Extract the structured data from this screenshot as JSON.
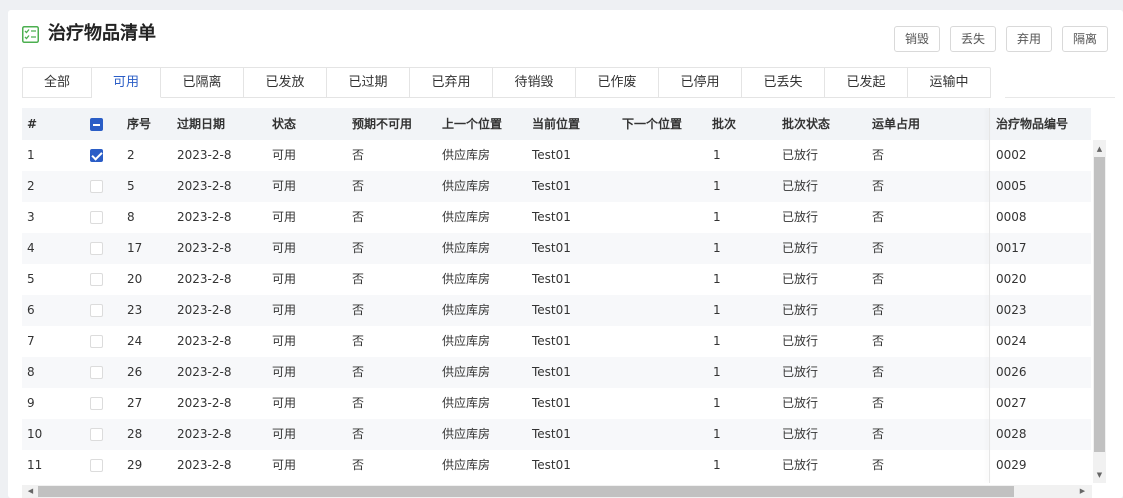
{
  "header": {
    "title": "治疗物品清单",
    "title_icon": "checklist-icon",
    "actions": [
      "销毁",
      "丢失",
      "弃用",
      "隔离"
    ]
  },
  "tabs": [
    "全部",
    "可用",
    "已隔离",
    "已发放",
    "已过期",
    "已弃用",
    "待销毁",
    "已作废",
    "已停用",
    "已丢失",
    "已发起",
    "运输中"
  ],
  "active_tab": "可用",
  "table": {
    "columns": [
      "#",
      "",
      "序号",
      "过期日期",
      "状态",
      "预期不可用",
      "上一个位置",
      "当前位置",
      "下一个位置",
      "批次",
      "批次状态",
      "运单占用",
      "治疗物品编号"
    ],
    "rows": [
      {
        "index": "1",
        "checked": true,
        "seq": "2",
        "expiry": "2023-2-8",
        "status": "可用",
        "expected_unavailable": "否",
        "prev_location": "供应库房",
        "current_location": "Test01",
        "next_location": "",
        "batch": "1",
        "batch_status": "已放行",
        "waybill": "否",
        "item_no": "0002"
      },
      {
        "index": "2",
        "checked": false,
        "seq": "5",
        "expiry": "2023-2-8",
        "status": "可用",
        "expected_unavailable": "否",
        "prev_location": "供应库房",
        "current_location": "Test01",
        "next_location": "",
        "batch": "1",
        "batch_status": "已放行",
        "waybill": "否",
        "item_no": "0005"
      },
      {
        "index": "3",
        "checked": false,
        "seq": "8",
        "expiry": "2023-2-8",
        "status": "可用",
        "expected_unavailable": "否",
        "prev_location": "供应库房",
        "current_location": "Test01",
        "next_location": "",
        "batch": "1",
        "batch_status": "已放行",
        "waybill": "否",
        "item_no": "0008"
      },
      {
        "index": "4",
        "checked": false,
        "seq": "17",
        "expiry": "2023-2-8",
        "status": "可用",
        "expected_unavailable": "否",
        "prev_location": "供应库房",
        "current_location": "Test01",
        "next_location": "",
        "batch": "1",
        "batch_status": "已放行",
        "waybill": "否",
        "item_no": "0017"
      },
      {
        "index": "5",
        "checked": false,
        "seq": "20",
        "expiry": "2023-2-8",
        "status": "可用",
        "expected_unavailable": "否",
        "prev_location": "供应库房",
        "current_location": "Test01",
        "next_location": "",
        "batch": "1",
        "batch_status": "已放行",
        "waybill": "否",
        "item_no": "0020"
      },
      {
        "index": "6",
        "checked": false,
        "seq": "23",
        "expiry": "2023-2-8",
        "status": "可用",
        "expected_unavailable": "否",
        "prev_location": "供应库房",
        "current_location": "Test01",
        "next_location": "",
        "batch": "1",
        "batch_status": "已放行",
        "waybill": "否",
        "item_no": "0023"
      },
      {
        "index": "7",
        "checked": false,
        "seq": "24",
        "expiry": "2023-2-8",
        "status": "可用",
        "expected_unavailable": "否",
        "prev_location": "供应库房",
        "current_location": "Test01",
        "next_location": "",
        "batch": "1",
        "batch_status": "已放行",
        "waybill": "否",
        "item_no": "0024"
      },
      {
        "index": "8",
        "checked": false,
        "seq": "26",
        "expiry": "2023-2-8",
        "status": "可用",
        "expected_unavailable": "否",
        "prev_location": "供应库房",
        "current_location": "Test01",
        "next_location": "",
        "batch": "1",
        "batch_status": "已放行",
        "waybill": "否",
        "item_no": "0026"
      },
      {
        "index": "9",
        "checked": false,
        "seq": "27",
        "expiry": "2023-2-8",
        "status": "可用",
        "expected_unavailable": "否",
        "prev_location": "供应库房",
        "current_location": "Test01",
        "next_location": "",
        "batch": "1",
        "batch_status": "已放行",
        "waybill": "否",
        "item_no": "0027"
      },
      {
        "index": "10",
        "checked": false,
        "seq": "28",
        "expiry": "2023-2-8",
        "status": "可用",
        "expected_unavailable": "否",
        "prev_location": "供应库房",
        "current_location": "Test01",
        "next_location": "",
        "batch": "1",
        "batch_status": "已放行",
        "waybill": "否",
        "item_no": "0028"
      },
      {
        "index": "11",
        "checked": false,
        "seq": "29",
        "expiry": "2023-2-8",
        "status": "可用",
        "expected_unavailable": "否",
        "prev_location": "供应库房",
        "current_location": "Test01",
        "next_location": "",
        "batch": "1",
        "batch_status": "已放行",
        "waybill": "否",
        "item_no": "0029"
      }
    ]
  },
  "colors": {
    "accent": "#2a5dc6",
    "header_bg": "#f2f4f7",
    "stripe_bg": "#f7f8fa",
    "icon_green": "#4caf50"
  }
}
